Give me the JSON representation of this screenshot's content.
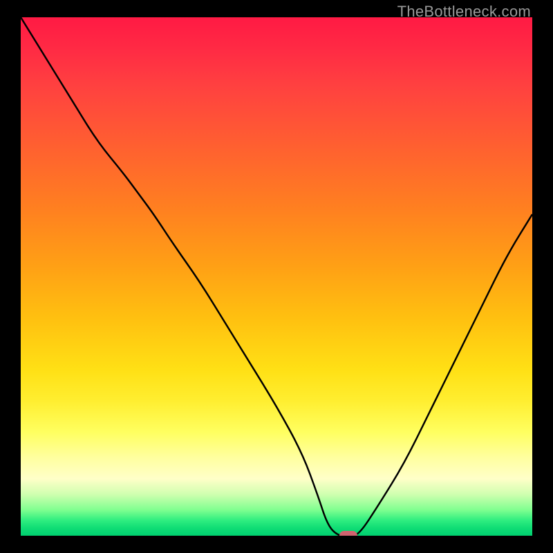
{
  "watermark": "TheBottleneck.com",
  "chart_data": {
    "type": "line",
    "title": "",
    "xlabel": "",
    "ylabel": "",
    "xlim": [
      0,
      100
    ],
    "ylim": [
      0,
      100
    ],
    "grid": false,
    "legend": false,
    "series": [
      {
        "name": "bottleneck-curve",
        "x": [
          0,
          5,
          10,
          15,
          20,
          23,
          26,
          30,
          35,
          40,
          45,
          50,
          55,
          58,
          60,
          62,
          64,
          66,
          70,
          75,
          80,
          85,
          90,
          95,
          100
        ],
        "y": [
          100,
          92,
          84,
          76,
          70,
          66,
          62,
          56,
          49,
          41,
          33,
          25,
          16,
          8,
          2,
          0,
          0,
          0,
          6,
          14,
          24,
          34,
          44,
          54,
          62
        ]
      }
    ],
    "marker": {
      "x": 64,
      "y": 0,
      "color": "#d0636f"
    },
    "background": "green-yellow-red vertical gradient"
  },
  "icons": {
    "marker_name": "optimal-point-marker"
  }
}
